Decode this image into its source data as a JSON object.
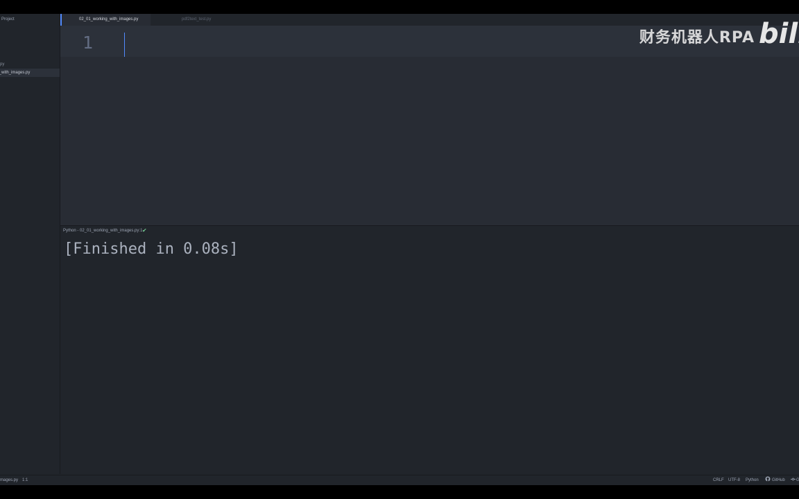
{
  "sidebar": {
    "title": "Project",
    "files": [
      "es.py",
      "ng_with_images.py"
    ]
  },
  "tabs": {
    "active": "02_01_working_with_images.py",
    "inactive": "pdf2text_test.py"
  },
  "editor": {
    "line_number": "1"
  },
  "watermark": {
    "text": "财务机器人RPA",
    "logo_text": "bili"
  },
  "panel": {
    "title": "Python - 02_01_working_with_images.py:1",
    "status_icon": "✔"
  },
  "output": {
    "text": "[Finished in 0.08s]"
  },
  "statusbar": {
    "file": "mages.py",
    "position": "1:1",
    "line_ending": "CRLF",
    "encoding": "UTF-8",
    "grammar": "Python",
    "github": "GitHub",
    "git": "G"
  }
}
